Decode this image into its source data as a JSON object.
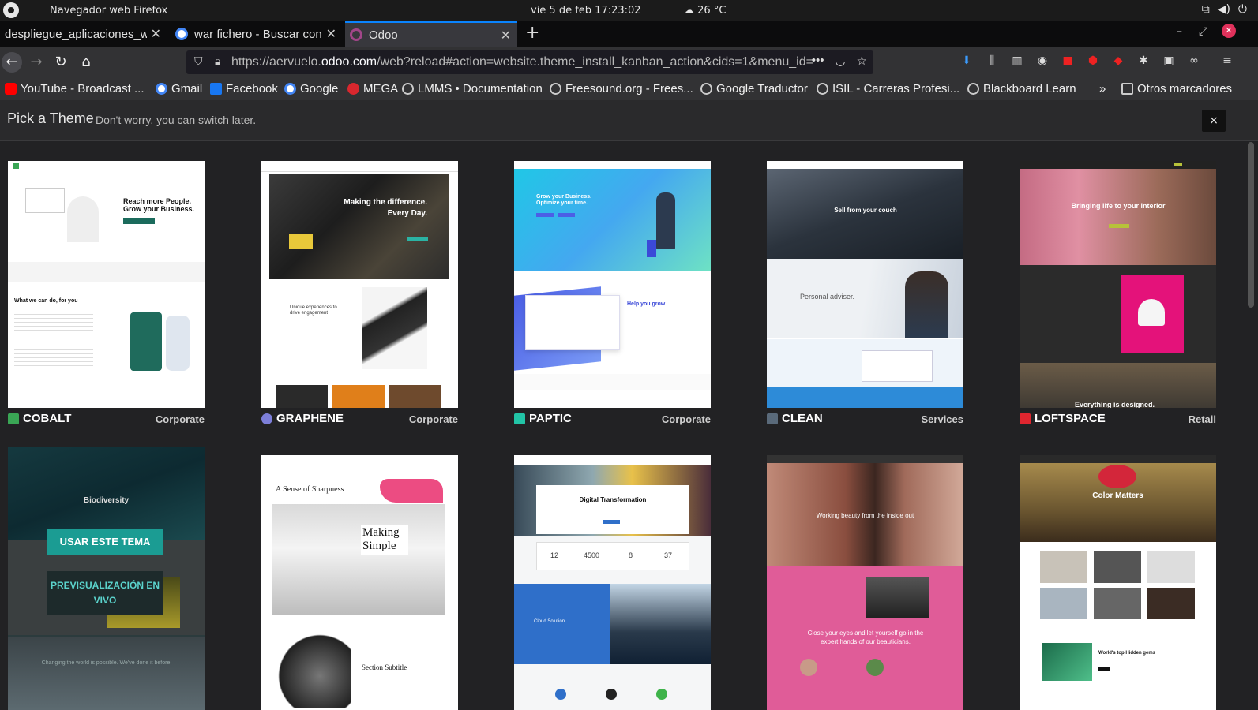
{
  "system_bar": {
    "app_name": "Navegador web Firefox",
    "clock": "vie  5 de feb  17:23:02",
    "weather": "26 °C"
  },
  "tabs": [
    {
      "title": "despliegue_aplicaciones_we",
      "active": false
    },
    {
      "title": "war fichero - Buscar con",
      "active": false
    },
    {
      "title": "Odoo",
      "active": true
    }
  ],
  "navbar": {
    "url_prefix": "https://aervuelo.",
    "url_domain": "odoo.com",
    "url_rest": "/web?reload#action=website.theme_install_kanban_action&cids=1&menu_id=",
    "more": "•••"
  },
  "bookmarks": [
    {
      "label": "YouTube - Broadcast ...",
      "color": "#ff0000"
    },
    {
      "label": "Gmail",
      "color": "#ffffff"
    },
    {
      "label": "Facebook",
      "color": "#1877f2"
    },
    {
      "label": "Google",
      "color": "#ffffff"
    },
    {
      "label": "MEGA",
      "color": "#d9272e"
    },
    {
      "label": "LMMS • Documentation",
      "color": "#666666"
    },
    {
      "label": "Freesound.org - Frees...",
      "color": "#666666"
    },
    {
      "label": "Google Traductor",
      "color": "#666666"
    },
    {
      "label": "ISIL - Carreras Profesi...",
      "color": "#666666"
    },
    {
      "label": "Blackboard Learn",
      "color": "#666666"
    },
    {
      "label": "Otros marcadores",
      "color": "#666666"
    }
  ],
  "header": {
    "title": "Pick a Theme",
    "subtitle": "Don't worry, you can switch later.",
    "close": "×"
  },
  "themes": [
    {
      "name": "COBALT",
      "category": "Corporate",
      "logo_color": "#3aa655",
      "headline": "Reach more People. Grow your Business.",
      "section": "What we can do, for you"
    },
    {
      "name": "GRAPHENE",
      "category": "Corporate",
      "logo_color": "#7d7fd9",
      "headline": "Making the difference. Every Day.",
      "section": "Unique experiences to drive engagement"
    },
    {
      "name": "PAPTIC",
      "category": "Corporate",
      "logo_color": "#22c4a6",
      "headline": "Grow your Business. Optimize your time.",
      "section": "Help you grow"
    },
    {
      "name": "CLEAN",
      "category": "Services",
      "logo_color": "#5a6a7a",
      "headline": "Sell from your couch",
      "section": "Personal adviser."
    },
    {
      "name": "LOFTSPACE",
      "category": "Retail",
      "logo_color": "#e0262f",
      "headline": "Bringing life to your interior",
      "section": "Everything is designed."
    }
  ],
  "second_row": [
    {
      "headline": "Biodiversity",
      "footer": "Changing the world is possible. We've done it before.",
      "button_use": "USAR ESTE TEMA",
      "button_preview": "PREVISUALIZACIÓN EN VIVO"
    },
    {
      "headline": "A Sense of Sharpness",
      "big": "Making Simple",
      "sub": "Section Subtitle"
    },
    {
      "headline": "Digital Transformation",
      "stats": [
        "12",
        "4500",
        "8",
        "37"
      ],
      "sub": "Cloud Solution"
    },
    {
      "headline": "Working beauty from the inside out",
      "sub": "Close your eyes and let yourself go in the expert hands of our beauticians."
    },
    {
      "headline": "Color Matters",
      "sub": "World's top Hidden gems"
    }
  ]
}
